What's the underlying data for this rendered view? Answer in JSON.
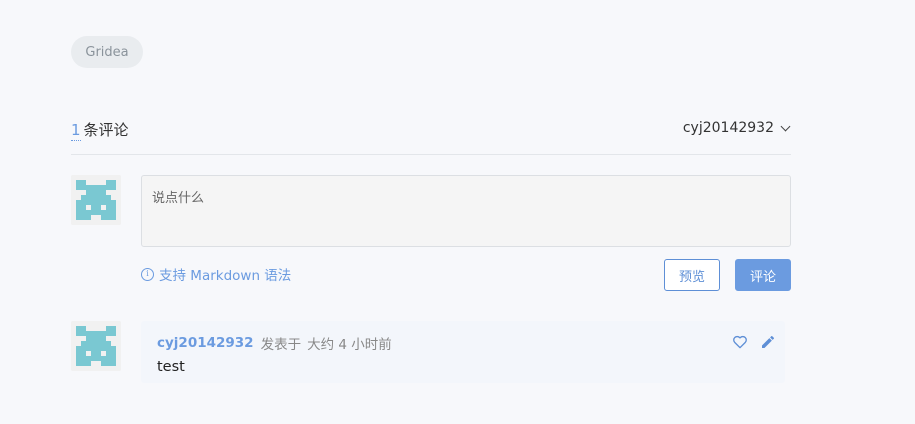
{
  "tag": {
    "label": "Gridea"
  },
  "comments_header": {
    "count": "1",
    "count_label": "条评论",
    "current_user": "cyj20142932"
  },
  "editor": {
    "placeholder": "说点什么",
    "markdown_hint": "支持 Markdown 语法",
    "preview_label": "预览",
    "submit_label": "评论"
  },
  "comments": [
    {
      "author": "cyj20142932",
      "posted_label": "发表于",
      "time": "大约 4 小时前",
      "body": "test"
    }
  ],
  "colors": {
    "accent": "#6b9be0",
    "avatar_pattern": "#7ac8d2",
    "background": "#f7f8fb"
  },
  "icons": [
    "info-icon",
    "heart-icon",
    "pencil-icon",
    "chevron-down-icon"
  ]
}
